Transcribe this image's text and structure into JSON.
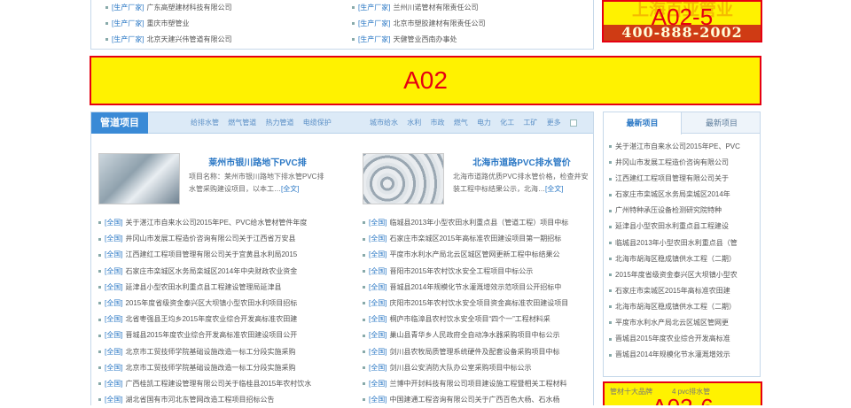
{
  "top_list": {
    "tag": "[生产厂家]",
    "left": [
      "广东高塑建材科技有限公司",
      "重庆市塑管业",
      "北京天建兴伟管道有限公司"
    ],
    "right": [
      "兰州川诺管材有限责任公司",
      "北京市塑胶建材有限责任公司",
      "天健管业西南办事处"
    ]
  },
  "ads": {
    "a02_5": {
      "label": "A02-5",
      "background_text": "上海百亚管业",
      "phone": "400-888-2002"
    },
    "a02": {
      "label": "A02"
    },
    "a02_6": {
      "label": "A02-6",
      "small_left": "管材十大品牌",
      "small_right": "4  pvc排水管"
    }
  },
  "main": {
    "title": "管道项目",
    "left_subtabs": [
      "给排水管",
      "燃气管道",
      "热力管道",
      "电缆保护"
    ],
    "right_subtabs": [
      "城市给水",
      "水利",
      "市政",
      "燃气",
      "电力",
      "化工",
      "工矿",
      "更多"
    ],
    "left_feature": {
      "title": "莱州市银川路地下PVC排",
      "desc": "项目名称：莱州市银川路地下排水管PVC排水管采购建设项目，以本工…",
      "more": "[全文]"
    },
    "right_feature": {
      "title": "北海市道路PVC排水管价",
      "desc": "北海市道路优质PVC排水管价格，检查井安装工程中标结果公示，北海…",
      "more": "[全文]"
    },
    "tag": "[全国]",
    "left_list": [
      "关于湛江市自来水公司2015年PE、PVC给水管材管件年度",
      "井冈山市发展工程造价咨询有限公司关于江西省万安县",
      "江西建红工程项目管理有限公司关于宜黄县水利局2015",
      "石家庄市栾城区水务局栾城区2014年中央财政农业资金",
      "延津县小型农田水利重点县工程建设管理局延津县",
      "2015年度省级资金泰兴区大坝镇小型农田水利项目招标",
      "北省枣强县王均乡2015年度农业综合开发高标准农田建",
      "晋城县2015年度农业综合开发高标准农田建设项目公开",
      "北京市工贸技师学院基础设施改造一标工分段实施采购",
      "北京市工贸技师学院基础设施改造一标工分段实施采购",
      "广西桂凯工程建设管理有限公司关于临桂县2015年农村饮水",
      "湖北省国有市河北东管网改造工程项目招标公告"
    ],
    "right_list": [
      "临城县2013年小型农田水利重点县（管道工程）项目中标",
      "石家庄市栾城区2015年高标准农田建设项目第一期招标",
      "平度市水利水产局北云区城区管网更新工程中标结果公",
      "晋阳市2015年农村饮水安全工程项目中标公示",
      "晋城县2014年规模化节水灌溉增效示范项目公开招标中",
      "庆阳市2015年农村饮水安全项目资金高标准农田建设项目",
      "桐庐市临漳县农村饮水安全项目“四个一”工程材料采",
      "巢山县青华乡人民政府全自动净水器采购项目中标公示",
      "剑川县农牧局质管理系统硬件及配套设备采购项目中标",
      "剑川县公安消防大队办公室采购项目中标公示",
      "兰博中开封料技有限公司项目建设施工程暨相关工程材料",
      "中国建通工程咨询有限公司关于广西百色大杨、石水杨"
    ]
  },
  "side": {
    "tabs": [
      "最新项目",
      "最新项目"
    ],
    "list": [
      "关于湛江市自来水公司2015年PE、PVC",
      "井冈山市发展工程造价咨询有限公司",
      "江西建红工程项目管理有限公司关于",
      "石家庄市栾城区水务局栾城区2014年",
      "广州特种承压设备检测研究院特种",
      "延津县小型农田水利重点县工程建设",
      "临城县2013年小型农田水利重点县（管",
      "北海市胡海区稳成镇供水工程（二期）",
      "2015年度省级资金泰兴区大坝镇小型农",
      "石家庄市栾城区2015年高标准农田建",
      "北海市胡海区稳成镇供水工程（二期）",
      "平度市水利水产局北云区城区管网更",
      "晋城县2015年度农业综合开发高标准",
      "晋城县2014年规模化节水灌溉增效示"
    ]
  }
}
